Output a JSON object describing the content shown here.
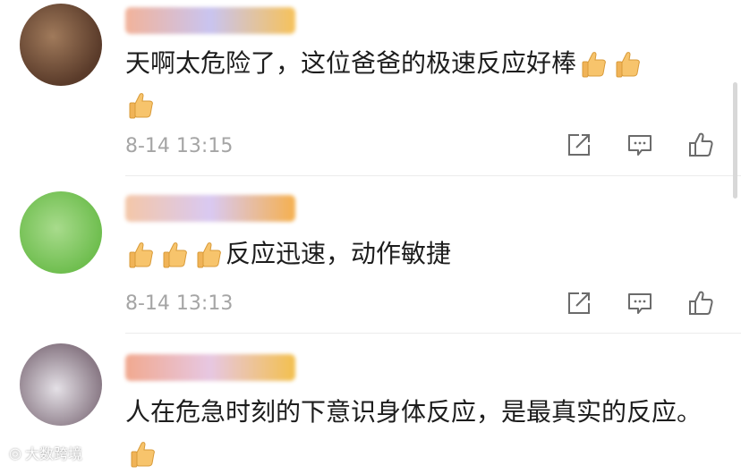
{
  "comments": [
    {
      "text": "天啊太危险了，这位爸爸的极速反应好棒",
      "trailing_emoji": [
        "thumbs-up",
        "thumbs-up",
        "thumbs-up"
      ],
      "time": "8-14 13:15",
      "avatar_colors": [
        "#5a3b2a",
        "#a07a5b"
      ],
      "name_colors": [
        "#f2b39a",
        "#c9c4f0",
        "#f6c25a"
      ]
    },
    {
      "leading_emoji": [
        "thumbs-up",
        "thumbs-up",
        "thumbs-up"
      ],
      "text": "反应迅速，动作敏捷",
      "time": "8-14 13:13",
      "avatar_colors": [
        "#6fbe4f",
        "#a8db8c"
      ],
      "name_colors": [
        "#f4c7a8",
        "#d9c9f2",
        "#f5b04f"
      ]
    },
    {
      "text": "人在危急时刻的下意识身体反应，是最真实的反应。",
      "trailing_emoji": [
        "thumbs-up"
      ],
      "avatar_colors": [
        "#8a7a86",
        "#e4e0e6"
      ],
      "name_colors": [
        "#f1a98f",
        "#e7c7e2",
        "#f3c04e"
      ]
    }
  ],
  "actions": {
    "share_icon": "share-icon",
    "comment_icon": "comment-icon",
    "like_icon": "like-icon"
  },
  "watermark": "大数跨境",
  "colors": {
    "time_text": "#a5a5a5",
    "icon_stroke": "#6b6b6b",
    "emoji_fill": "#f7c46c"
  }
}
